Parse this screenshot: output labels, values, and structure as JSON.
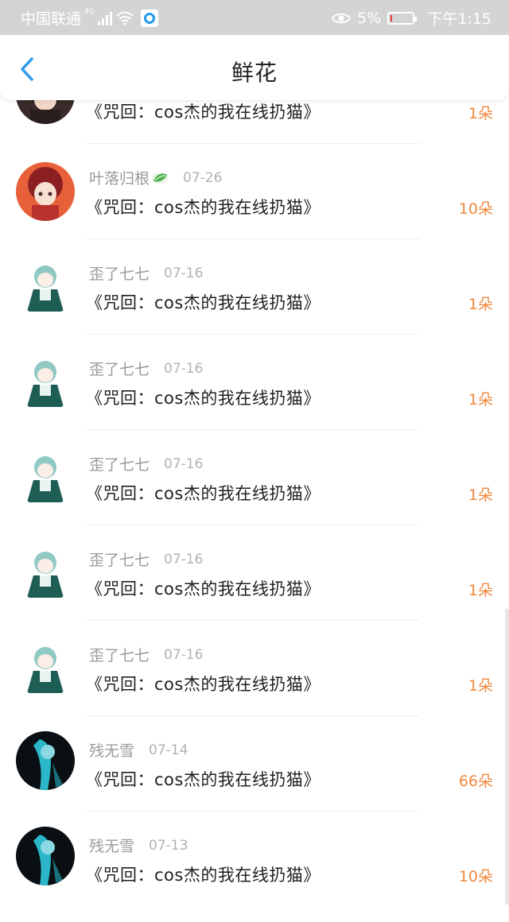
{
  "status_bar": {
    "carrier": "中国联通",
    "network": "4G",
    "battery": "5%",
    "time": "下午1:15"
  },
  "header": {
    "title": "鲜花"
  },
  "colors": {
    "accent_blue": "#2b9cf0",
    "count_orange": "#f0883e"
  },
  "rows": [
    {
      "name": "",
      "date": "",
      "book": "《咒回：cos杰的我在线扔猫》",
      "count": "1朵",
      "avatar": "dark-girl"
    },
    {
      "name": "叶落归根",
      "date": "07-26",
      "book": "《咒回：cos杰的我在线扔猫》",
      "count": "10朵",
      "avatar": "red-girl",
      "badge": "leaf-icon"
    },
    {
      "name": "歪了七七",
      "date": "07-16",
      "book": "《咒回：cos杰的我在线扔猫》",
      "count": "1朵",
      "avatar": "green-chibi"
    },
    {
      "name": "歪了七七",
      "date": "07-16",
      "book": "《咒回：cos杰的我在线扔猫》",
      "count": "1朵",
      "avatar": "green-chibi"
    },
    {
      "name": "歪了七七",
      "date": "07-16",
      "book": "《咒回：cos杰的我在线扔猫》",
      "count": "1朵",
      "avatar": "green-chibi"
    },
    {
      "name": "歪了七七",
      "date": "07-16",
      "book": "《咒回：cos杰的我在线扔猫》",
      "count": "1朵",
      "avatar": "green-chibi"
    },
    {
      "name": "歪了七七",
      "date": "07-16",
      "book": "《咒回：cos杰的我在线扔猫》",
      "count": "1朵",
      "avatar": "green-chibi"
    },
    {
      "name": "残无雪",
      "date": "07-14",
      "book": "《咒回：cos杰的我在线扔猫》",
      "count": "66朵",
      "avatar": "cyan-dark"
    },
    {
      "name": "残无雪",
      "date": "07-13",
      "book": "《咒回：cos杰的我在线扔猫》",
      "count": "10朵",
      "avatar": "cyan-dark"
    }
  ]
}
